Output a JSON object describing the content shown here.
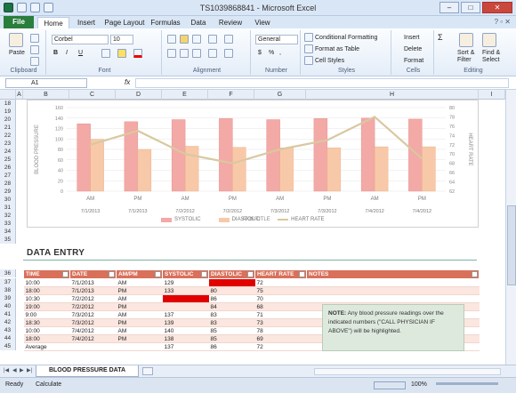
{
  "window": {
    "title": "TS1039868841 - Microsoft Excel"
  },
  "tabs": [
    "File",
    "Home",
    "Insert",
    "Page Layout",
    "Formulas",
    "Data",
    "Review",
    "View"
  ],
  "ribbon": {
    "clipboard": {
      "paste": "Paste",
      "label": "Clipboard"
    },
    "font": {
      "name": "Corbel",
      "size": "10",
      "label": "Font",
      "bold": "B",
      "italic": "I",
      "underline": "U"
    },
    "alignment": {
      "label": "Alignment"
    },
    "number": {
      "format": "General",
      "currency": "$",
      "percent": "%",
      "comma": ",",
      "label": "Number"
    },
    "styles": {
      "cond": "Conditional Formatting",
      "table": "Format as Table",
      "cell": "Cell Styles",
      "label": "Styles"
    },
    "cells": {
      "insert": "Insert",
      "delete": "Delete",
      "format": "Format",
      "label": "Cells"
    },
    "editing": {
      "sum": "Σ",
      "sort": "Sort &",
      "sort2": "Filter",
      "find": "Find &",
      "find2": "Select",
      "label": "Editing"
    }
  },
  "formula": {
    "cell": "A1",
    "fx": "fx",
    "value": ""
  },
  "columns": [
    "A",
    "B",
    "C",
    "D",
    "E",
    "F",
    "G",
    "H",
    "I"
  ],
  "rows": [
    "18",
    "19",
    "20",
    "21",
    "22",
    "23",
    "24",
    "25",
    "26",
    "27",
    "28",
    "29",
    "30",
    "31",
    "32",
    "33",
    "34",
    "35",
    "36",
    "37",
    "38",
    "39",
    "40",
    "41",
    "42",
    "43",
    "44",
    "45"
  ],
  "chart_data": {
    "type": "bar",
    "categories": [
      "7/1/2013 AM",
      "7/1/2013 PM",
      "7/2/2012 AM",
      "7/2/2012 PM",
      "7/3/2012 AM",
      "7/3/2012 PM",
      "7/4/2012 AM",
      "7/4/2012 PM"
    ],
    "group_labels": [
      "AM",
      "PM",
      "AM",
      "PM",
      "AM",
      "PM",
      "AM",
      "PM"
    ],
    "date_labels": [
      "7/1/2013",
      "7/1/2013",
      "7/2/2012",
      "7/2/2012",
      "7/3/2012",
      "7/3/2012",
      "7/4/2012",
      "7/4/2012"
    ],
    "series": [
      {
        "name": "SYSTOLIC",
        "values": [
          129,
          133,
          137,
          139,
          137,
          139,
          140,
          138
        ],
        "color": "#f3a9a6"
      },
      {
        "name": "DIASTOLIC",
        "values": [
          99,
          80,
          86,
          84,
          83,
          83,
          85,
          85
        ],
        "color": "#f8c9a8"
      },
      {
        "name": "HEART RATE",
        "values": [
          72,
          75,
          70,
          68,
          71,
          73,
          78,
          69
        ],
        "color": "#d9c8a0"
      }
    ],
    "ylabel": "BLOOD PRESSURE",
    "y2label": "HEART RATE",
    "xlabel": "AXIS TITLE",
    "ylim": [
      0,
      160
    ],
    "y2lim": [
      62,
      80
    ],
    "yticks": [
      "0",
      "20",
      "40",
      "60",
      "80",
      "100",
      "120",
      "140",
      "160"
    ],
    "y2ticks": [
      "62",
      "64",
      "66",
      "68",
      "70",
      "72",
      "74",
      "76",
      "78",
      "80"
    ],
    "grid": true,
    "legend": "bottom"
  },
  "section_title": "DATA ENTRY",
  "table": {
    "headers": [
      "TIME",
      "DATE",
      "AM/PM",
      "SYSTOLIC",
      "DIASTOLIC",
      "HEART RATE",
      "NOTES"
    ],
    "rows": [
      [
        "10:00",
        "7/1/2013",
        "AM",
        "129",
        "",
        "72",
        ""
      ],
      [
        "18:00",
        "7/1/2013",
        "PM",
        "133",
        "80",
        "75",
        ""
      ],
      [
        "10:30",
        "7/2/2012",
        "AM",
        "",
        "86",
        "70",
        ""
      ],
      [
        "19:00",
        "7/2/2012",
        "PM",
        "",
        "84",
        "68",
        ""
      ],
      [
        "9:00",
        "7/3/2012",
        "AM",
        "137",
        "83",
        "71",
        ""
      ],
      [
        "18:30",
        "7/3/2012",
        "PM",
        "139",
        "83",
        "73",
        ""
      ],
      [
        "10:00",
        "7/4/2012",
        "AM",
        "140",
        "85",
        "78",
        ""
      ],
      [
        "18:00",
        "7/4/2012",
        "PM",
        "138",
        "85",
        "69",
        ""
      ],
      [
        "Average",
        "",
        "",
        "137",
        "86",
        "72",
        ""
      ]
    ],
    "highlighted": [
      [
        0,
        4
      ],
      [
        2,
        3
      ],
      [
        3,
        3
      ]
    ]
  },
  "note": {
    "bold": "NOTE:",
    "text": " Any blood pressure readings over the indicated numbers (\"CALL PHYSICIAN IF ABOVE\") will be highlighted."
  },
  "sheet": {
    "name": "BLOOD PRESSURE DATA"
  },
  "status": {
    "left": "Ready",
    "mode": "Calculate",
    "zoom": "100%"
  }
}
